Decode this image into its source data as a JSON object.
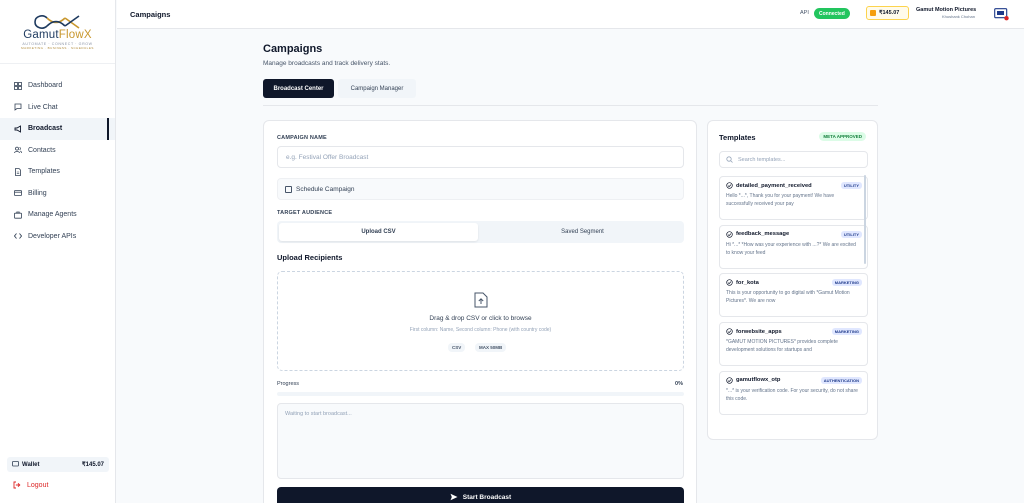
{
  "brand": {
    "name_a": "Gamut",
    "name_b": "FlowX",
    "tagline": "AUTOMATE · CONNECT · GROW",
    "subtag": "MARKETING · BUSINESS · SCHEDULES"
  },
  "sidebar": {
    "items": [
      {
        "label": "Dashboard",
        "icon": "dashboard-icon"
      },
      {
        "label": "Live Chat",
        "icon": "chat-icon"
      },
      {
        "label": "Broadcast",
        "icon": "megaphone-icon"
      },
      {
        "label": "Contacts",
        "icon": "contacts-icon"
      },
      {
        "label": "Templates",
        "icon": "file-icon"
      },
      {
        "label": "Billing",
        "icon": "card-icon"
      },
      {
        "label": "Manage Agents",
        "icon": "briefcase-icon"
      },
      {
        "label": "Developer APIs",
        "icon": "code-icon"
      }
    ],
    "wallet_label": "Wallet",
    "wallet_amount": "₹145.07",
    "logout_label": "Logout"
  },
  "topbar": {
    "title": "Campaigns",
    "api_label": "API",
    "api_status": "Connected",
    "balance": "₹145.07",
    "org_name": "Gamut Motion Pictures",
    "org_user": "Khushank Chohan"
  },
  "page": {
    "title": "Campaigns",
    "subtitle": "Manage broadcasts and track delivery stats.",
    "tab_active": "Broadcast Center",
    "tab_other": "Campaign Manager"
  },
  "form": {
    "campaign_name_label": "CAMPAIGN NAME",
    "campaign_name_placeholder": "e.g. Festival Offer Broadcast",
    "schedule_label": "Schedule Campaign",
    "audience_label": "TARGET AUDIENCE",
    "audience_upload": "Upload CSV",
    "audience_segment": "Saved Segment",
    "upload_title": "Upload Recipients",
    "drop_text": "Drag & drop CSV or click to browse",
    "drop_hint": "First column: Name, Second column: Phone (with country code)",
    "chip_csv": "CSV",
    "chip_max": "MAX 50MB",
    "progress_label": "Progress",
    "progress_text": "0%",
    "progress_value": 0,
    "log_placeholder": "Waiting to start broadcast...",
    "start_label": "Start Broadcast"
  },
  "templates": {
    "title": "Templates",
    "badge": "META APPROVED",
    "search_placeholder": "Search templates...",
    "items": [
      {
        "name": "detailed_payment_received",
        "category": "UTILITY",
        "body": "Hello *...*, Thank you for your payment! We have successfully received your pay"
      },
      {
        "name": "feedback_message",
        "category": "UTILITY",
        "body": "Hi *...* *How was your experience with ...?* We are excited to know your feed"
      },
      {
        "name": "for_kota",
        "category": "MARKETING",
        "body": "This is your opportunity to go digital with *Gamut Motion Pictures*. We are now"
      },
      {
        "name": "forwebsite_apps",
        "category": "MARKETING",
        "body": "*GAMUT MOTION PICTURES* provides complete development solutions for startups and"
      },
      {
        "name": "gamutflowx_otp",
        "category": "AUTHENTICATION",
        "body": "*...* is your verification code. For your security, do not share this code."
      }
    ]
  },
  "colors": {
    "primary": "#0f172a",
    "connected": "#22c55e",
    "logout": "#dc2626",
    "brand_gold": "#c8972e"
  }
}
